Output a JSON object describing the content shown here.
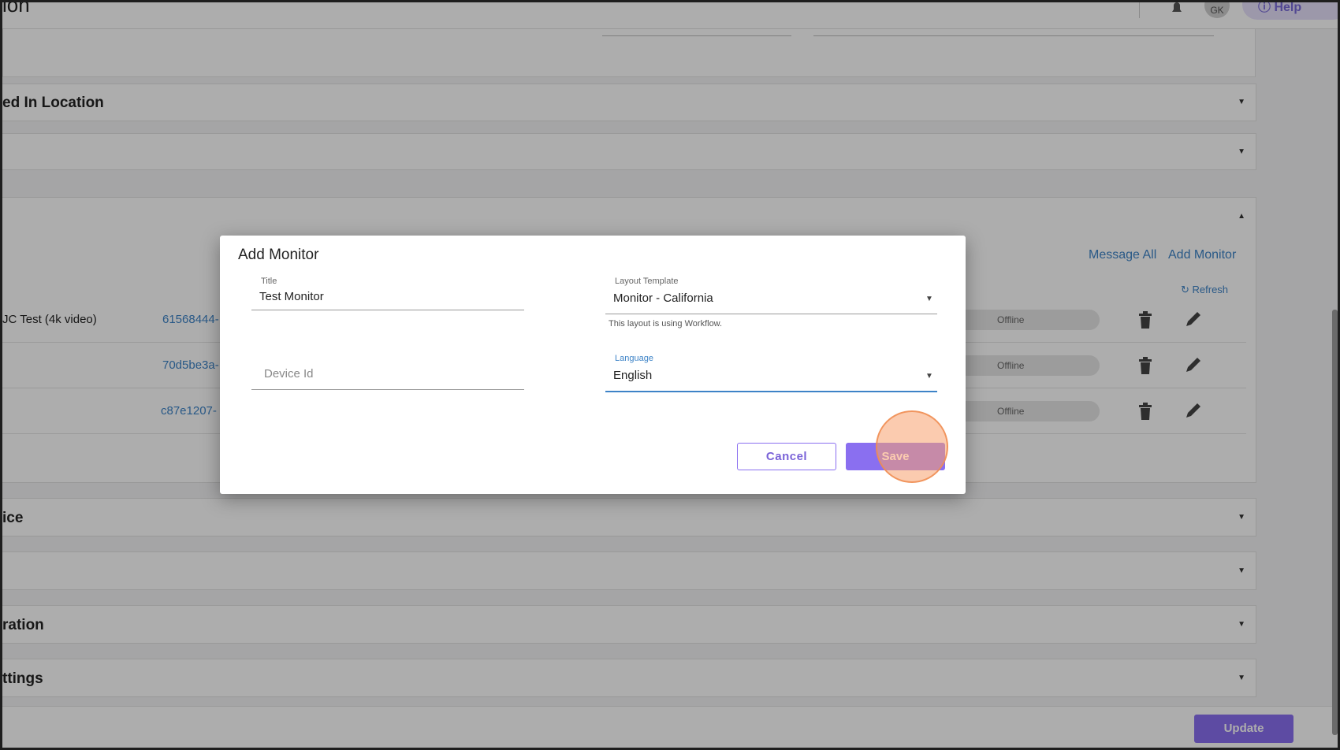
{
  "header": {
    "page_title_fragment": "ion",
    "avatar_initials": "GK",
    "help_label": "Help"
  },
  "sections": [
    {
      "title": "ed In Location",
      "expanded": false
    },
    {
      "title": "",
      "expanded": false
    },
    {
      "title": "",
      "expanded": true
    },
    {
      "title": "ice",
      "expanded": false
    },
    {
      "title": "",
      "expanded": false
    },
    {
      "title": "ration",
      "expanded": false
    },
    {
      "title": "ttings",
      "expanded": false
    }
  ],
  "devices": {
    "message_all_label": "Message All",
    "add_monitor_label": "Add Monitor",
    "refresh_label": "Refresh",
    "rows": [
      {
        "name": "JC Test (4k video)",
        "id": "61568444-",
        "status": "Offline"
      },
      {
        "name": "",
        "id": "70d5be3a-",
        "status": "Offline"
      },
      {
        "name": "",
        "id": "c87e1207-",
        "status": "Offline"
      }
    ]
  },
  "footer": {
    "update_label": "Update"
  },
  "modal": {
    "title": "Add Monitor",
    "title_field": {
      "label": "Title",
      "value": "Test Monitor"
    },
    "device_id_field": {
      "placeholder": "Device Id",
      "value": ""
    },
    "layout_template": {
      "label": "Layout Template",
      "value": "Monitor - California",
      "helper": "This layout is using Workflow."
    },
    "language": {
      "label": "Language",
      "value": "English"
    },
    "cancel_label": "Cancel",
    "save_label": "Save"
  },
  "colors": {
    "accent": "#8a6ff0",
    "link": "#3d83c7",
    "focus": "#3d83c7",
    "click_indicator": "#f8a06e"
  }
}
